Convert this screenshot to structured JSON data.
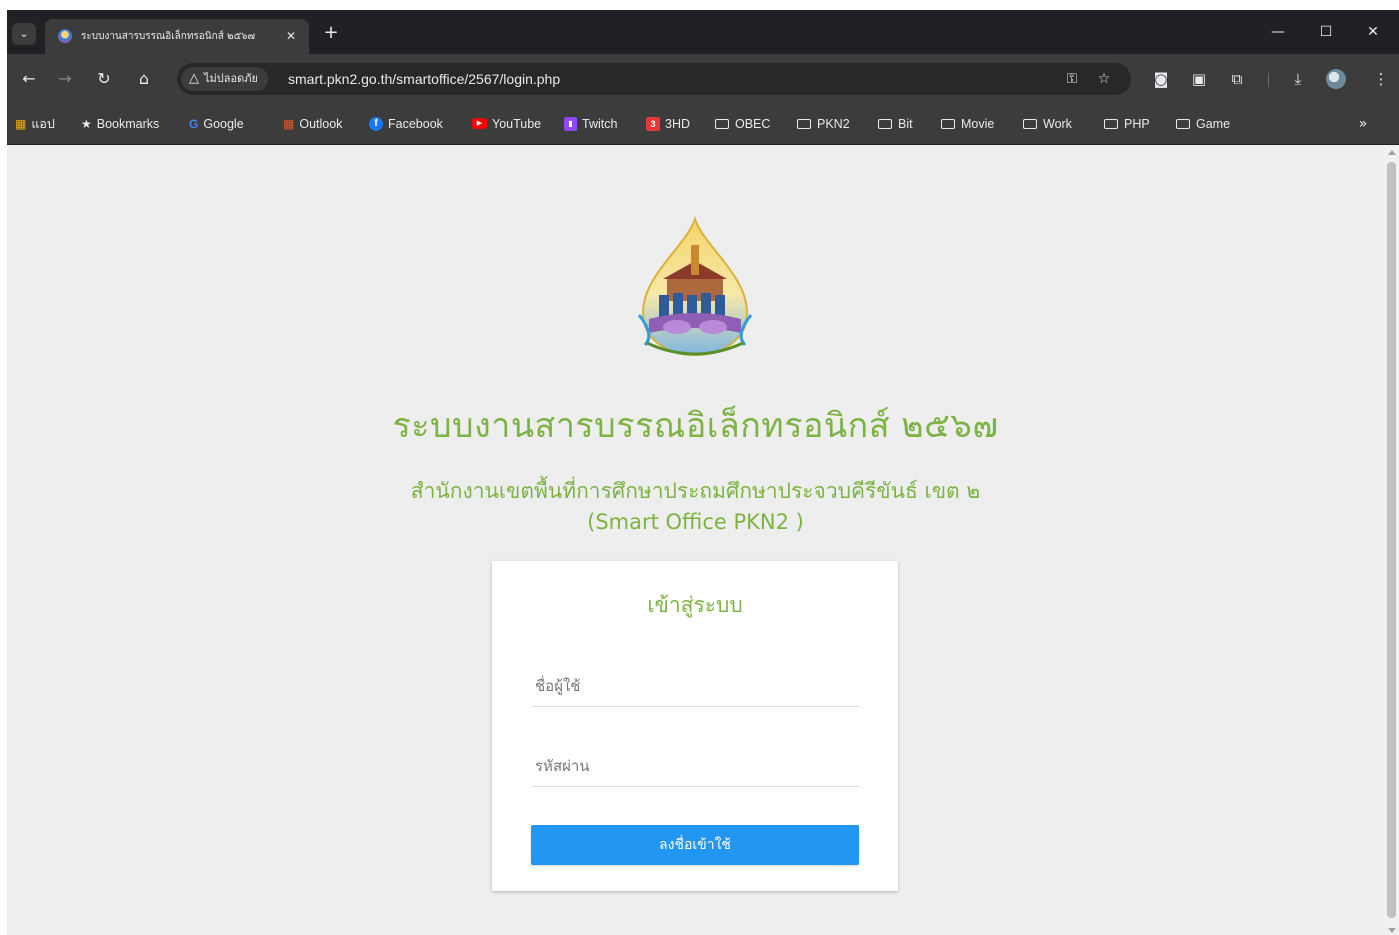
{
  "tab": {
    "title": "ระบบงานสารบรรณอิเล็กทรอนิกส์ ๒๕๖๗",
    "close_glyph": "✕",
    "new_glyph": "+"
  },
  "window_controls": {
    "minimize": "—",
    "maximize": "☐",
    "close": "✕"
  },
  "toolbar": {
    "back": "←",
    "forward": "→",
    "reload": "↻",
    "home": "⌂",
    "security_label": "ไม่ปลอดภัย",
    "security_glyph": "△",
    "url": "smart.pkn2.go.th/smartoffice/2567/login.php",
    "key_glyph": "⚿",
    "star_glyph": "☆",
    "camera_glyph": "◙",
    "cast_glyph": "▣",
    "extensions_glyph": "⧉",
    "download_glyph": "⤓",
    "menu_glyph": "⋮"
  },
  "bookmarks": {
    "apps": "แอป",
    "items": [
      {
        "label": "Bookmarks",
        "icon": "★"
      },
      {
        "label": "Google",
        "icon": "G"
      },
      {
        "label": "Outlook",
        "icon": "▦"
      },
      {
        "label": "Facebook",
        "icon": "f"
      },
      {
        "label": "YouTube",
        "icon": "▶"
      },
      {
        "label": "Twitch",
        "icon": "▮"
      },
      {
        "label": "3HD",
        "icon": "3"
      }
    ],
    "folders": [
      "OBEC",
      "PKN2",
      "Bit",
      "Movie",
      "Work",
      "PHP",
      "Game"
    ],
    "more": "»",
    "colors": {
      "google": "#4285f4",
      "outlook": "#f25022",
      "facebook": "#1877f2",
      "youtube": "#ff0000",
      "twitch": "#9146ff",
      "3hd": "#e53935"
    }
  },
  "page": {
    "title": "ระบบงานสารบรรณอิเล็กทรอนิกส์ ๒๕๖๗",
    "subtitle": "สำนักงานเขตพื้นที่การศึกษาประถมศึกษาประจวบคีรีขันธ์ เขต ๒",
    "subtitle2": "(Smart Office PKN2 )",
    "accent": "#7cb342",
    "button_color": "#2196f3"
  },
  "login": {
    "heading": "เข้าสู่ระบบ",
    "username_placeholder": "ชื่อผู้ใช้",
    "password_placeholder": "รหัสผ่าน",
    "submit_label": "ลงชื่อเข้าใช้"
  }
}
